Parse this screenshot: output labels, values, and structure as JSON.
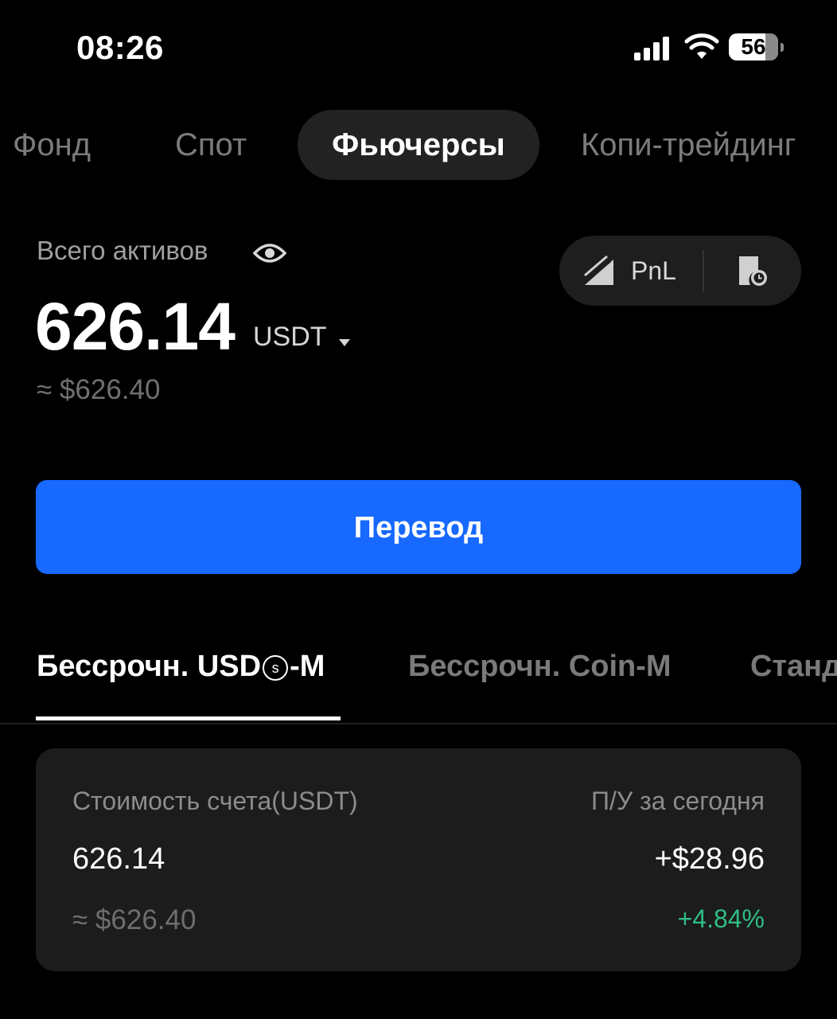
{
  "status_bar": {
    "time": "08:26",
    "battery_level": "56",
    "icons": [
      "signal-icon",
      "wifi-icon",
      "battery-icon"
    ]
  },
  "top_tabs": [
    {
      "label": "Фонд",
      "active": false
    },
    {
      "label": "Спот",
      "active": false
    },
    {
      "label": "Фьючерсы",
      "active": true
    },
    {
      "label": "Копи-трейдинг",
      "active": false
    }
  ],
  "summary": {
    "total_assets_label": "Всего активов",
    "balance": "626.14",
    "currency": "USDT",
    "approx_usd": "≈ $626.40",
    "pnl_label": "PnL",
    "icons": [
      "eye-icon",
      "pnl-chart-icon",
      "history-icon",
      "caret-down-icon"
    ]
  },
  "transfer_button": {
    "label": "Перевод"
  },
  "sub_tabs": {
    "items": [
      {
        "label_prefix": "Бессрочн. USD",
        "circled": "s",
        "label_suffix": "-M",
        "active": true
      },
      {
        "label": "Бессрочн. Coin-M",
        "active": false
      },
      {
        "label": "Станд",
        "active": false
      }
    ]
  },
  "account_card": {
    "value_label": "Стоимость счета(USDT)",
    "pnl_today_label": "П/У за сегодня",
    "value": "626.14",
    "pnl_today": "+$28.96",
    "value_usd": "≈ $626.40",
    "pnl_today_percent": "+4.84%"
  },
  "colors": {
    "background": "#000000",
    "accent_blue": "#1769ff",
    "positive_green": "#2ebd85",
    "card_bg": "#1c1c1c",
    "muted_text": "#7b7b7b"
  }
}
